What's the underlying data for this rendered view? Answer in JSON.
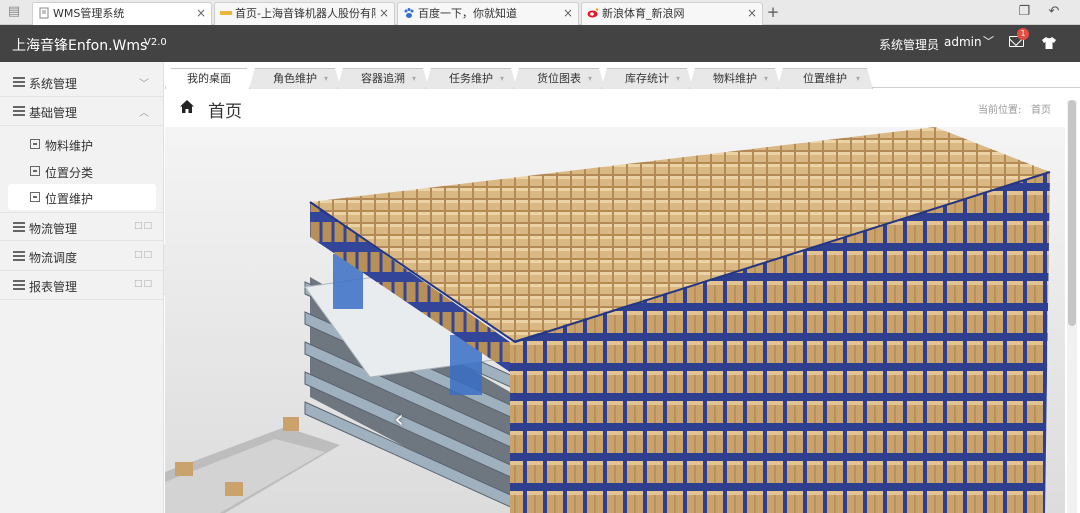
{
  "browser": {
    "tabs": [
      {
        "title": "WMS管理系统",
        "icon": "document-icon",
        "active": true
      },
      {
        "title": "首页-上海音锋机器人股份有限公",
        "icon": "site-favicon",
        "active": false
      },
      {
        "title": "百度一下，你就知道",
        "icon": "baidu-paw-icon",
        "active": false
      },
      {
        "title": "新浪体育_新浪网",
        "icon": "sina-weibo-icon",
        "active": false
      }
    ]
  },
  "header": {
    "title": "上海音锋Enfon.Wms",
    "version": "V2.0",
    "role": "系统管理员",
    "user": "admin",
    "mail_badge": "1"
  },
  "sidebar": {
    "menus": [
      {
        "label": "系统管理",
        "state": "collapsed"
      },
      {
        "label": "基础管理",
        "state": "expanded"
      },
      {
        "label": "物流管理",
        "state": "collapsed"
      },
      {
        "label": "物流调度",
        "state": "collapsed"
      },
      {
        "label": "报表管理",
        "state": "collapsed"
      }
    ],
    "submenu": [
      {
        "label": "物料维护",
        "active": false
      },
      {
        "label": "位置分类",
        "active": false
      },
      {
        "label": "位置维护",
        "active": true
      }
    ]
  },
  "tabs": [
    {
      "label": "我的桌面",
      "active": true
    },
    {
      "label": "角色维护",
      "active": false
    },
    {
      "label": "容器追溯",
      "active": false
    },
    {
      "label": "任务维护",
      "active": false
    },
    {
      "label": "货位图表",
      "active": false
    },
    {
      "label": "库存统计",
      "active": false
    },
    {
      "label": "物料维护",
      "active": false
    },
    {
      "label": "位置维护",
      "active": false
    }
  ],
  "content": {
    "title": "首页",
    "breadcrumb_label": "当前位置:",
    "breadcrumb_value": "首页",
    "carousel_image": "automated-warehouse-rack-photo"
  },
  "colors": {
    "header_bg": "#434343",
    "sidebar_bg": "#f2f2f2",
    "badge": "#e54d42",
    "rack_blue": "#3a4fa0",
    "carton": "#c9a36b"
  }
}
